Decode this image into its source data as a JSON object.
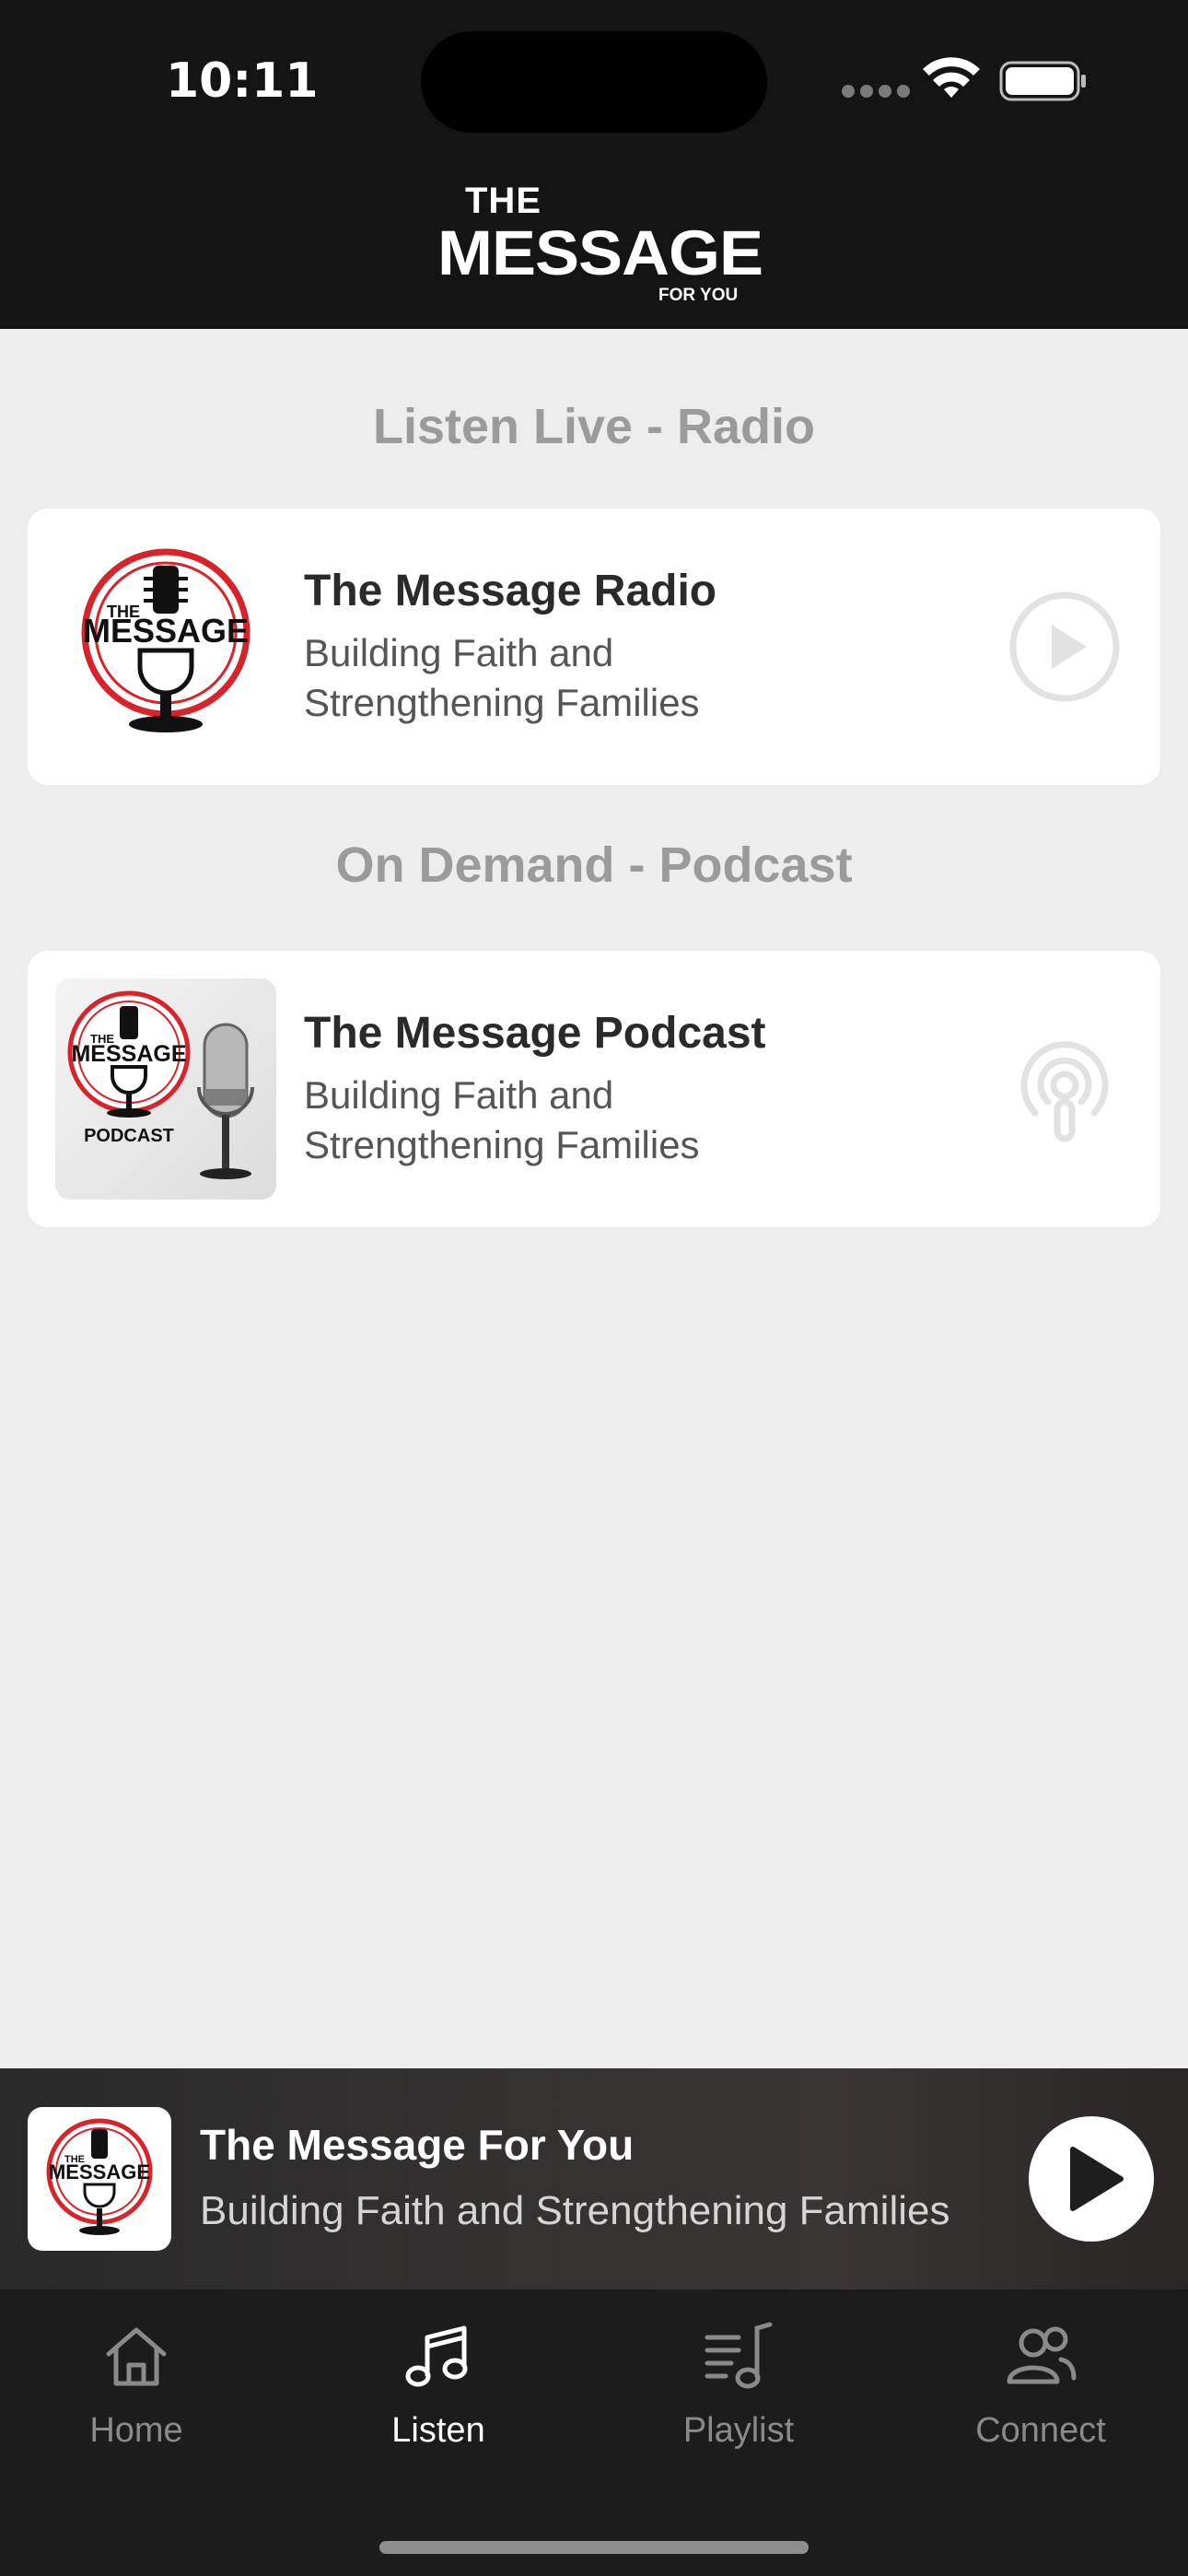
{
  "status_bar": {
    "time": "10:11"
  },
  "header": {
    "logo_the": "THE",
    "logo_message": "MESSAGE",
    "logo_for_you": "FOR YOU"
  },
  "sections": {
    "live_title": "Listen Live - Radio",
    "demand_title": "On Demand - Podcast"
  },
  "radio_card": {
    "title": "The Message Radio",
    "subtitle": "Building Faith and Strengthening Families",
    "action_icon": "play-circle-icon"
  },
  "podcast_card": {
    "title": "The Message Podcast",
    "subtitle": "Building Faith and Strengthening Families",
    "art_label": "PODCAST",
    "action_icon": "podcast-icon"
  },
  "mini_player": {
    "title": "The Message For You",
    "subtitle": "Building Faith and Strengthening Families",
    "action_icon": "play-icon"
  },
  "tabs": [
    {
      "label": "Home",
      "icon": "home-icon",
      "active": false
    },
    {
      "label": "Listen",
      "icon": "music-note-icon",
      "active": true
    },
    {
      "label": "Playlist",
      "icon": "playlist-icon",
      "active": false
    },
    {
      "label": "Connect",
      "icon": "people-icon",
      "active": false
    }
  ],
  "colors": {
    "header_bg": "#141414",
    "page_bg": "#ededed",
    "brand_red": "#d8232a",
    "tabbar_bg": "#1c1c1c"
  }
}
